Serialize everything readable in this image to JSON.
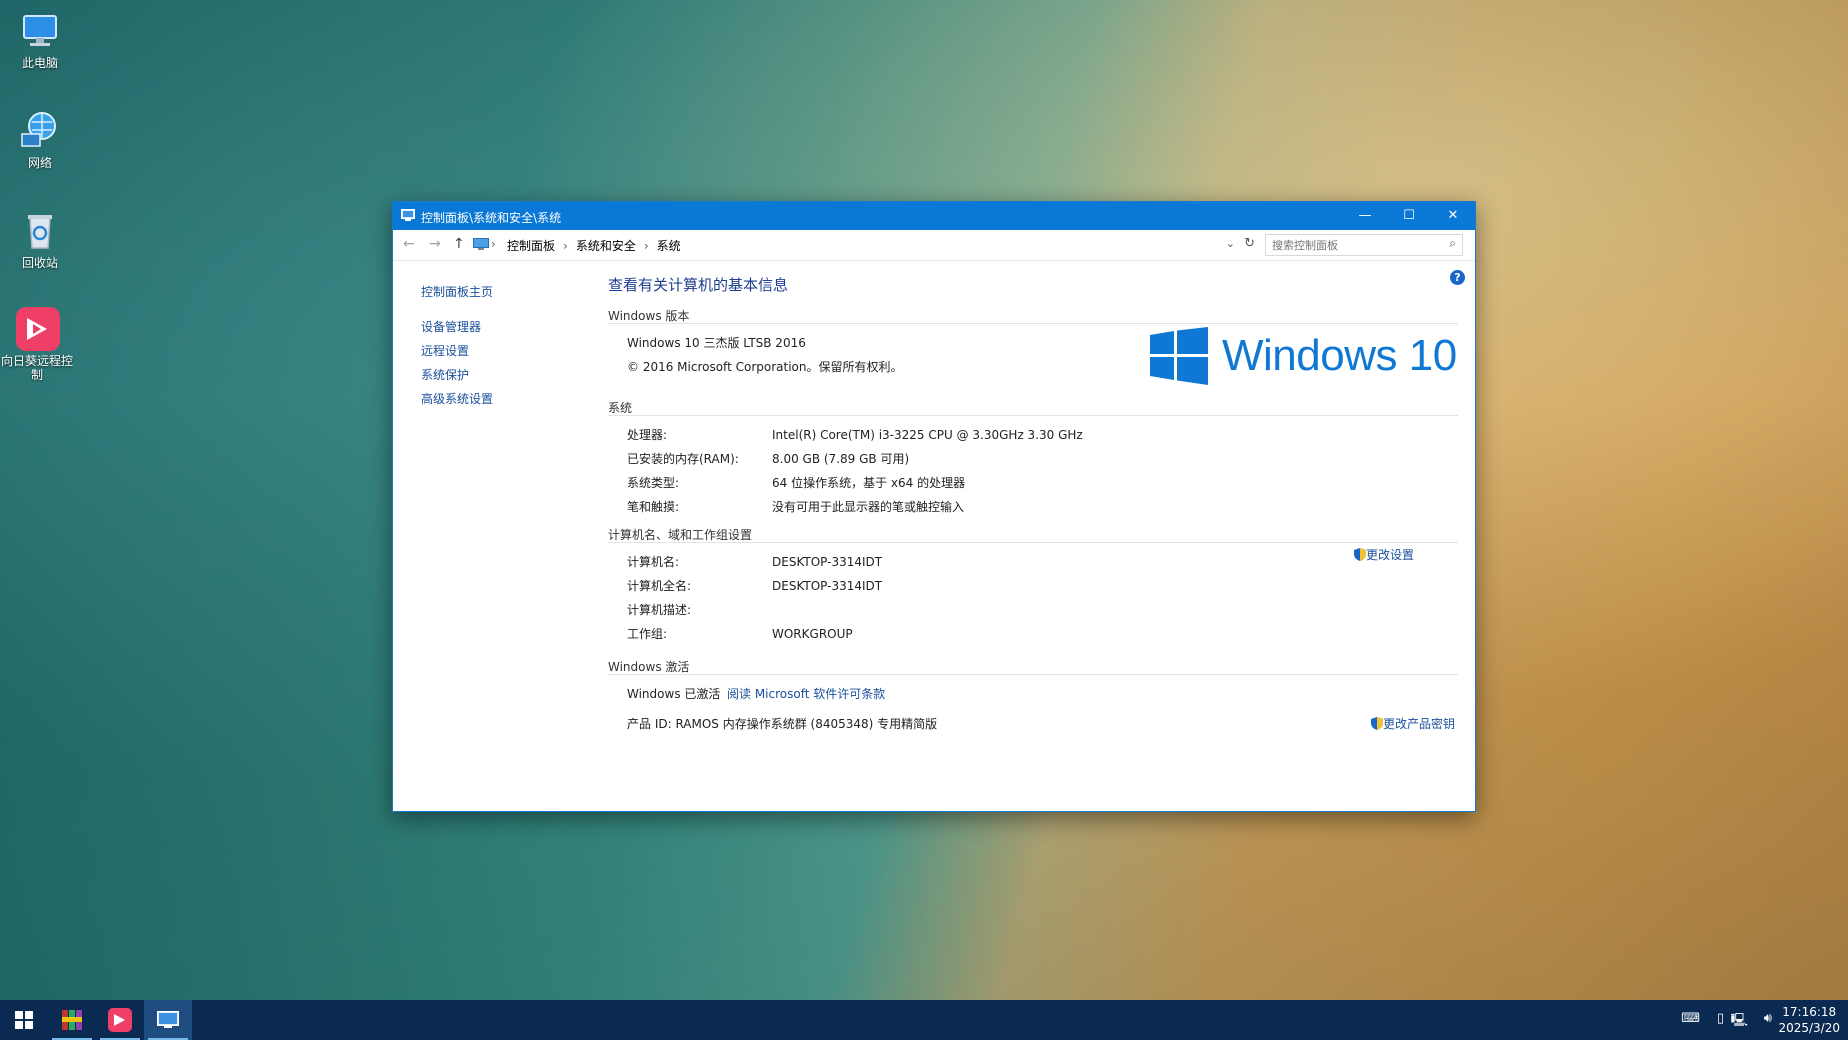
{
  "desktop": {
    "icons": [
      {
        "label": "此电脑",
        "icon": "this-pc-icon"
      },
      {
        "label": "网络",
        "icon": "network-icon"
      },
      {
        "label": "回收站",
        "icon": "recycle-bin-icon"
      },
      {
        "label": "向日葵远程控制",
        "icon": "sunlogin-icon"
      }
    ]
  },
  "window": {
    "title": "控制面板\\系统和安全\\系统",
    "controls": {
      "minimize": "—",
      "maximize": "☐",
      "close": "✕"
    },
    "breadcrumb": [
      "控制面板",
      "系统和安全",
      "系统"
    ],
    "search_placeholder": "搜索控制面板",
    "help": "?",
    "left_nav": {
      "home": "控制面板主页",
      "items": [
        "设备管理器",
        "远程设置",
        "系统保护",
        "高级系统设置"
      ]
    },
    "heading": "查看有关计算机的基本信息",
    "windows_edition": {
      "header": "Windows 版本",
      "edition": "Windows 10 三杰版 LTSB 2016",
      "copyright": "© 2016 Microsoft Corporation。保留所有权利。",
      "logo_text": "Windows 10"
    },
    "system": {
      "header": "系统",
      "rows": [
        {
          "label": "处理器:",
          "value": "Intel(R) Core(TM) i3-3225 CPU @ 3.30GHz   3.30 GHz"
        },
        {
          "label": "已安装的内存(RAM):",
          "value": "8.00 GB (7.89 GB 可用)"
        },
        {
          "label": "系统类型:",
          "value": "64 位操作系统，基于 x64 的处理器"
        },
        {
          "label": "笔和触摸:",
          "value": "没有可用于此显示器的笔或触控输入"
        }
      ]
    },
    "computer_name": {
      "header": "计算机名、域和工作组设置",
      "change_link": "更改设置",
      "rows": [
        {
          "label": "计算机名:",
          "value": "DESKTOP-3314IDT"
        },
        {
          "label": "计算机全名:",
          "value": "DESKTOP-3314IDT"
        },
        {
          "label": "计算机描述:",
          "value": ""
        },
        {
          "label": "工作组:",
          "value": "WORKGROUP"
        }
      ]
    },
    "activation": {
      "header": "Windows 激活",
      "status": "Windows 已激活",
      "license_link": "阅读 Microsoft 软件许可条款",
      "product_id": "产品 ID: RAMOS 内存操作系统群 (8405348) 专用精简版",
      "change_key_link": "更改产品密钥"
    }
  },
  "taskbar": {
    "time": "17:16:18",
    "date": "2025/3/20",
    "colors": {
      "background": "#0a2a52",
      "active_indicator": "#76b9ed"
    }
  }
}
